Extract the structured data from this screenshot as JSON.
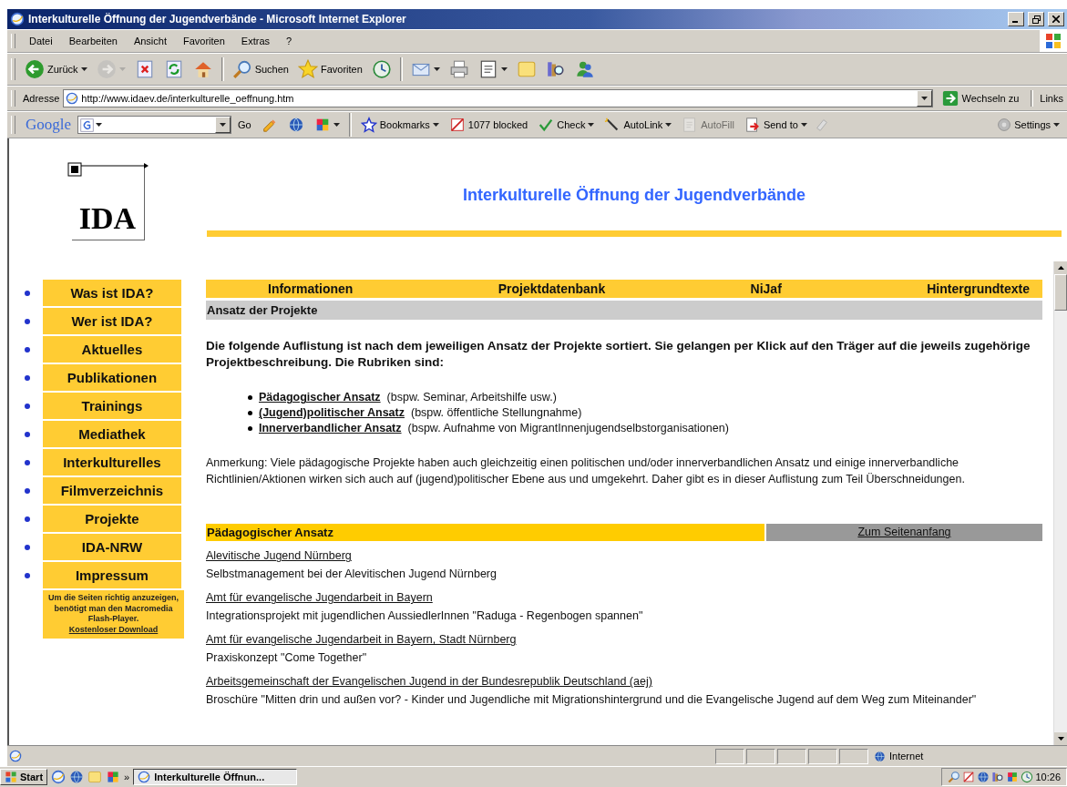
{
  "window": {
    "title": "Interkulturelle Öffnung der Jugendverbände - Microsoft Internet Explorer"
  },
  "menu": [
    "Datei",
    "Bearbeiten",
    "Ansicht",
    "Favoriten",
    "Extras",
    "?"
  ],
  "toolbar_groups": [
    [
      {
        "kind": "back",
        "label": "Zurück",
        "menu": true,
        "disabled": false
      },
      {
        "kind": "forward",
        "menu": true,
        "disabled": true
      },
      {
        "kind": "stop",
        "disabled": false
      },
      {
        "kind": "refresh",
        "disabled": false
      },
      {
        "kind": "home",
        "disabled": false
      }
    ],
    [
      {
        "kind": "search",
        "label": "Suchen",
        "disabled": false
      },
      {
        "kind": "favorites",
        "label": "Favoriten",
        "disabled": false
      },
      {
        "kind": "history",
        "disabled": false
      }
    ],
    [
      {
        "kind": "mail",
        "menu": true,
        "disabled": false
      },
      {
        "kind": "print",
        "disabled": false
      },
      {
        "kind": "edit",
        "menu": true,
        "disabled": false
      },
      {
        "kind": "note",
        "disabled": false
      },
      {
        "kind": "research",
        "disabled": false
      },
      {
        "kind": "messenger",
        "disabled": false
      }
    ]
  ],
  "address": {
    "label": "Adresse",
    "value": "http://www.idaev.de/interkulturelle_oeffnung.htm",
    "go": "Wechseln zu",
    "links": "Links"
  },
  "google": {
    "logo": "Google",
    "go": "Go",
    "tools": [
      {
        "kind": "pencil",
        "menu": false
      },
      {
        "kind": "globe",
        "menu": false
      },
      {
        "kind": "puzzle",
        "menu": true
      }
    ],
    "items": [
      {
        "kind": "bookmarks",
        "label": "Bookmarks",
        "menu": true,
        "disabled": false
      },
      {
        "kind": "blocked",
        "label": "1077 blocked",
        "menu": false,
        "disabled": false
      },
      {
        "kind": "check",
        "label": "Check",
        "menu": true,
        "disabled": false
      },
      {
        "kind": "autolink",
        "label": "AutoLink",
        "menu": true,
        "disabled": false
      },
      {
        "kind": "autofill",
        "label": "AutoFill",
        "menu": false,
        "disabled": true
      },
      {
        "kind": "sendto",
        "label": "Send to",
        "menu": true,
        "disabled": false
      }
    ],
    "settings": "Settings"
  },
  "page": {
    "logo": "IDA",
    "title": "Interkulturelle Öffnung der Jugendverbände",
    "nav": [
      "Was ist IDA?",
      "Wer ist IDA?",
      "Aktuelles",
      "Publikationen",
      "Trainings",
      "Mediathek",
      "Interkulturelles",
      "Filmverzeichnis",
      "Projekte",
      "IDA-NRW",
      "Impressum"
    ],
    "flash_note": {
      "text": "Um die Seiten richtig anzuzeigen, benötigt man den Macromedia Flash-Player.",
      "link": "Kostenloser Download"
    },
    "tabs": [
      "Informationen",
      "Projektdatenbank",
      "NiJaf",
      "Hintergrundtexte"
    ],
    "section_title": "Ansatz der Projekte",
    "intro": "Die folgende Auflistung ist nach dem jeweiligen Ansatz der Projekte sortiert. Sie gelangen per Klick auf den Träger auf die jeweils zugehörige Projektbeschreibung. Die Rubriken sind:",
    "categories": [
      {
        "link": "Pädagogischer Ansatz",
        "note": "(bspw. Seminar, Arbeitshilfe usw.)"
      },
      {
        "link": "(Jugend)politischer Ansatz",
        "note": "(bspw. öffentliche Stellungnahme)"
      },
      {
        "link": "Innerverbandlicher Ansatz",
        "note": "(bspw. Aufnahme von MigrantInnenjugendselbstorganisationen)"
      }
    ],
    "remark": "Anmerkung: Viele pädagogische Projekte haben auch gleichzeitig einen politischen und/oder innerverbandlichen Ansatz und einige innerverbandliche Richtlinien/Aktionen wirken sich auch auf (jugend)politischer Ebene aus und umgekehrt. Daher gibt es in dieser Auflistung zum Teil Überschneidungen.",
    "section": {
      "heading": "Pädagogischer Ansatz",
      "top_link": "Zum Seitenanfang",
      "entries": [
        {
          "link": "Alevitische Jugend Nürnberg",
          "desc": "Selbstmanagement bei der Alevitischen Jugend Nürnberg"
        },
        {
          "link": "Amt für evangelische Jugendarbeit in Bayern",
          "desc": "Integrationsprojekt mit jugendlichen AussiedlerInnen \"Raduga - Regenbogen spannen\""
        },
        {
          "link": "Amt für evangelische Jugendarbeit in Bayern, Stadt Nürnberg",
          "desc": "Praxiskonzept \"Come Together\""
        },
        {
          "link": "Arbeitsgemeinschaft der Evangelischen Jugend in der Bundesrepublik Deutschland (aej)",
          "desc": "Broschüre \"Mitten drin und außen vor? - Kinder und Jugendliche mit Migrationshintergrund und die Evangelische Jugend auf dem Weg zum Miteinander\""
        }
      ]
    }
  },
  "status": {
    "zone": "Internet"
  },
  "taskbar": {
    "start": "Start",
    "more": "»",
    "task": "Interkulturelle Öffnun...",
    "clock": "10:26"
  }
}
